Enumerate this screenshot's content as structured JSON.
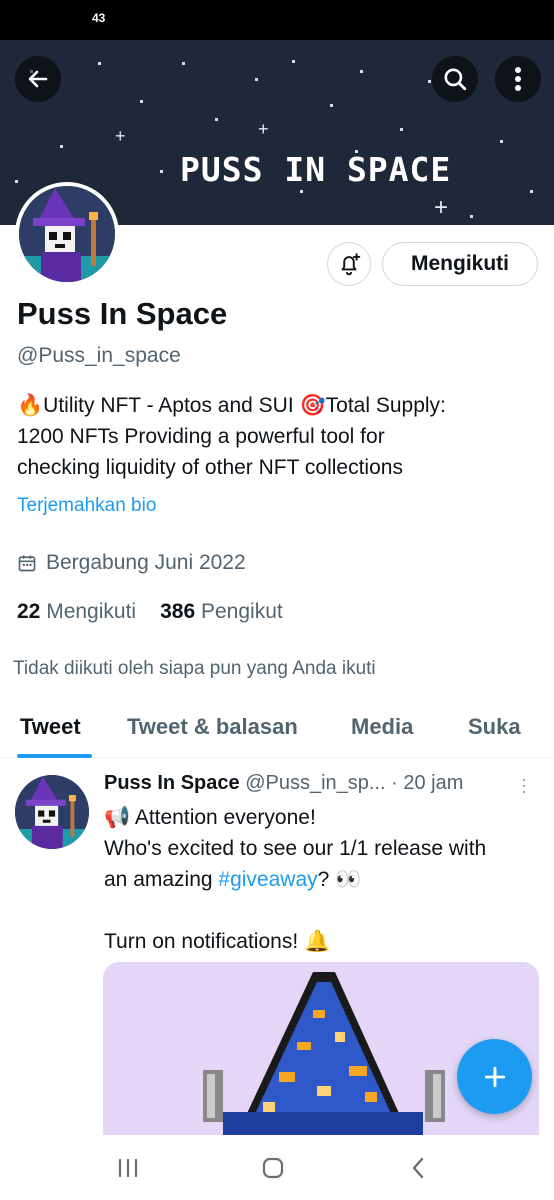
{
  "status_bar": {
    "time": "43"
  },
  "banner": {
    "title": "PUSS IN SPACE"
  },
  "icons": {
    "back": "arrow-left-icon",
    "search": "search-icon",
    "more": "more-vertical-icon",
    "notify": "bell-plus-icon",
    "calendar": "calendar-icon",
    "compose": "plus-icon"
  },
  "profile": {
    "name": "Puss In Space",
    "handle": "@Puss_in_space",
    "follow_label": "Mengikuti",
    "bio_lines": [
      "🔥Utility NFT - Aptos and SUI 🎯Total Supply:",
      "1200 NFTs  Providing a powerful tool for",
      "checking liquidity of other NFT collections"
    ],
    "translate_label": "Terjemahkan bio",
    "joined": "Bergabung Juni 2022",
    "following_count": "22",
    "following_label": "Mengikuti",
    "followers_count": "386",
    "followers_label": "Pengikut",
    "not_followed": "Tidak diikuti oleh siapa pun yang Anda ikuti"
  },
  "tabs": [
    {
      "label": "Tweet",
      "active": true
    },
    {
      "label": "Tweet & balasan",
      "active": false
    },
    {
      "label": "Media",
      "active": false
    },
    {
      "label": "Suka",
      "active": false
    }
  ],
  "tweet": {
    "name": "Puss In Space",
    "handle": "@Puss_in_sp...",
    "time": "· 20 jam",
    "line1": "📢 Attention everyone!",
    "line2": "Who's excited to see our 1/1 release with",
    "line3_pre": "an amazing ",
    "hashtag": "#giveaway",
    "line3_post": "? 👀",
    "line4": "Turn on notifications! 🔔"
  },
  "colors": {
    "accent": "#1d9bf0",
    "banner_bg": "#1f2838",
    "media_bg": "#e3d6f7"
  }
}
